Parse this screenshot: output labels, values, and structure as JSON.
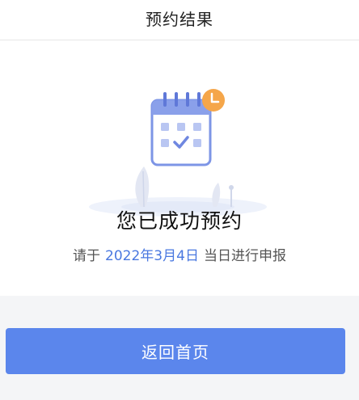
{
  "header": {
    "title": "预约结果"
  },
  "result": {
    "title": "您已成功预约",
    "desc_prefix": "请于",
    "date": "2022年3月4日",
    "desc_suffix": "当日进行申报"
  },
  "actions": {
    "home_label": "返回首页"
  },
  "colors": {
    "accent": "#5b86ec",
    "date_text": "#4a78e0",
    "clock_badge": "#f5a64a"
  },
  "icons": {
    "illustration": "calendar-check-icon",
    "badge": "clock-icon"
  }
}
